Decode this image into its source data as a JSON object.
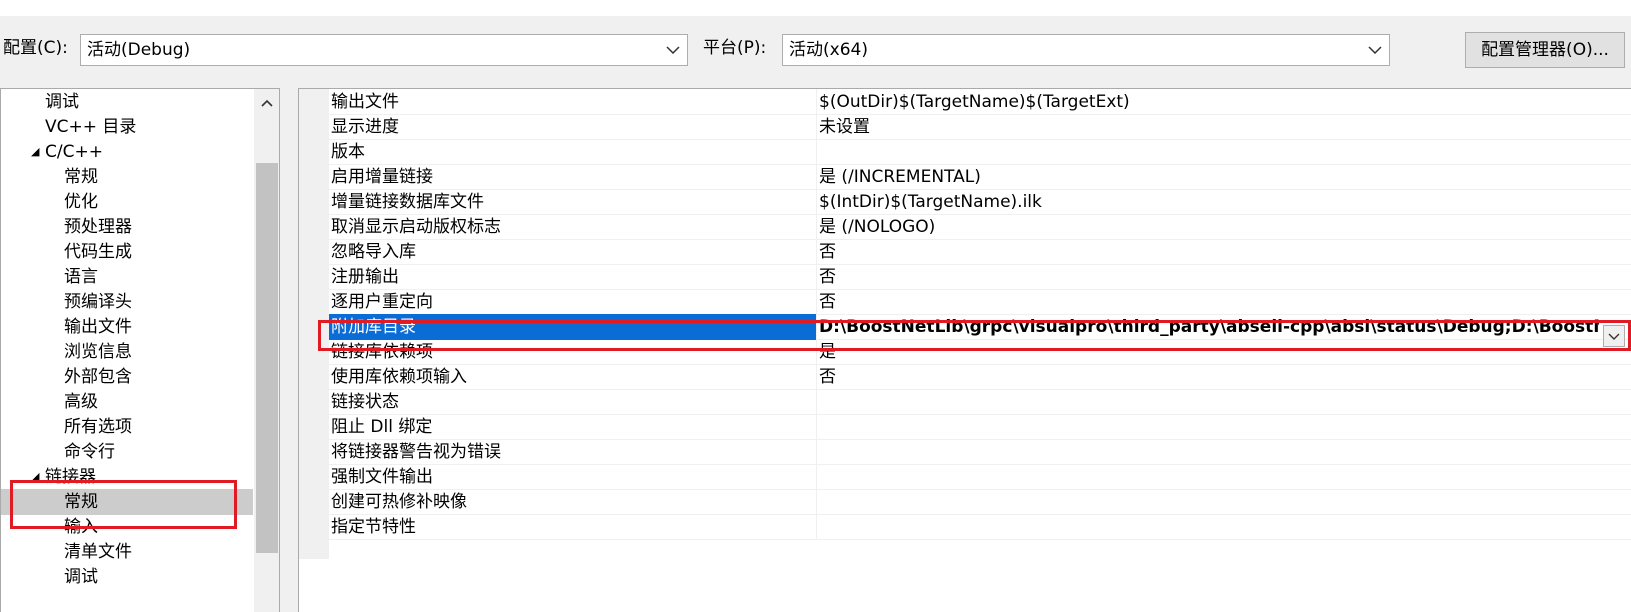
{
  "toolbar": {
    "config_label": "配置(C):",
    "config_value": "活动(Debug)",
    "platform_label": "平台(P):",
    "platform_value": "活动(x64)",
    "config_manager_label": "配置管理器(O)..."
  },
  "tree": {
    "items": [
      {
        "label": "调试"
      },
      {
        "label": "VC++ 目录"
      },
      {
        "label": "C/C++"
      },
      {
        "label": "常规"
      },
      {
        "label": "优化"
      },
      {
        "label": "预处理器"
      },
      {
        "label": "代码生成"
      },
      {
        "label": "语言"
      },
      {
        "label": "预编译头"
      },
      {
        "label": "输出文件"
      },
      {
        "label": "浏览信息"
      },
      {
        "label": "外部包含"
      },
      {
        "label": "高级"
      },
      {
        "label": "所有选项"
      },
      {
        "label": "命令行"
      },
      {
        "label": "链接器"
      },
      {
        "label": "常规"
      },
      {
        "label": "输入"
      },
      {
        "label": "清单文件"
      },
      {
        "label": "调试"
      }
    ]
  },
  "properties": {
    "rows": [
      {
        "name": "输出文件",
        "value": "$(OutDir)$(TargetName)$(TargetExt)"
      },
      {
        "name": "显示进度",
        "value": "未设置"
      },
      {
        "name": "版本",
        "value": ""
      },
      {
        "name": "启用增量链接",
        "value": "是 (/INCREMENTAL)"
      },
      {
        "name": "增量链接数据库文件",
        "value": "$(IntDir)$(TargetName).ilk"
      },
      {
        "name": "取消显示启动版权标志",
        "value": "是 (/NOLOGO)"
      },
      {
        "name": "忽略导入库",
        "value": "否"
      },
      {
        "name": "注册输出",
        "value": "否"
      },
      {
        "name": "逐用户重定向",
        "value": "否"
      },
      {
        "name": "附加库目录",
        "value": "D:\\BoostNetLib\\grpc\\visualpro\\third_party\\abseil-cpp\\absl\\status\\Debug;D:\\BoostNetL"
      },
      {
        "name": "链接库依赖项",
        "value": "是"
      },
      {
        "name": "使用库依赖项输入",
        "value": "否"
      },
      {
        "name": "链接状态",
        "value": ""
      },
      {
        "name": "阻止 Dll 绑定",
        "value": ""
      },
      {
        "name": "将链接器警告视为错误",
        "value": ""
      },
      {
        "name": "强制文件输出",
        "value": ""
      },
      {
        "name": "创建可热修补映像",
        "value": ""
      },
      {
        "name": "指定节特性",
        "value": ""
      }
    ]
  },
  "colors": {
    "selection": "#0a6cd6",
    "highlight_box": "#e01b24",
    "tree_selected": "#cccccc"
  }
}
